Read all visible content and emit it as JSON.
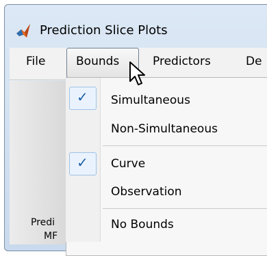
{
  "window": {
    "title": "Prediction Slice Plots"
  },
  "menubar": {
    "items": [
      {
        "label": "File"
      },
      {
        "label": "Bounds"
      },
      {
        "label": "Predictors"
      },
      {
        "label": "De"
      }
    ]
  },
  "left_panel": {
    "line1": "Predi",
    "line2": "MF"
  },
  "bounds_menu": {
    "items": [
      {
        "label": "Simultaneous",
        "checked": true
      },
      {
        "label": "Non-Simultaneous",
        "checked": false
      },
      {
        "label": "Curve",
        "checked": true
      },
      {
        "label": "Observation",
        "checked": false
      },
      {
        "label": "No Bounds",
        "checked": false
      }
    ],
    "check_glyph": "✓"
  }
}
